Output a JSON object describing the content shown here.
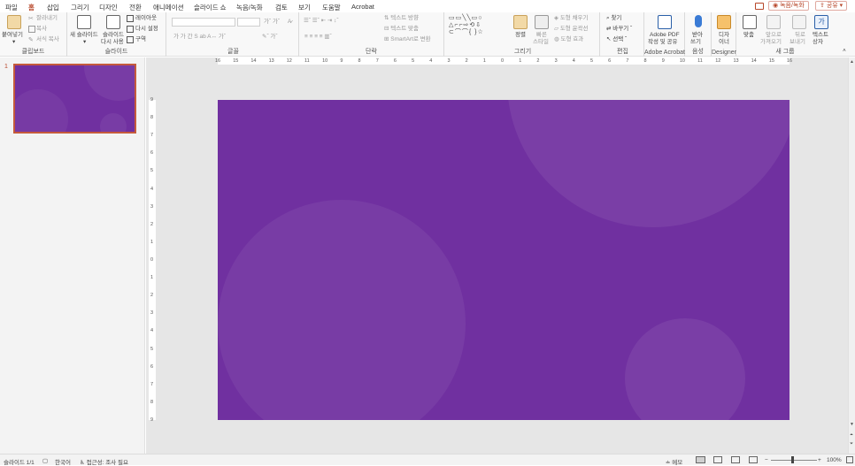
{
  "menu": {
    "tabs": [
      "파일",
      "홈",
      "삽입",
      "그리기",
      "디자인",
      "전환",
      "애니메이션",
      "슬라이드 쇼",
      "녹음/녹화",
      "검토",
      "보기",
      "도움말",
      "Acrobat"
    ],
    "active_tab": "홈",
    "record_button": "녹음/녹화",
    "share_button": "공유"
  },
  "ribbon": {
    "clipboard": {
      "paste": "붙여넣기",
      "cut": "잘라내기",
      "copy": "복사",
      "format_painter": "서식 복사",
      "group": "클립보드"
    },
    "slides": {
      "new_slide": "새 슬라이드",
      "reuse_line1": "슬라이드",
      "reuse_line2": "다시 사용",
      "layout": "레이아웃",
      "reset": "다시 설정",
      "section": "구역",
      "group": "슬라이드"
    },
    "font": {
      "group": "글꼴"
    },
    "paragraph": {
      "text_direction": "텍스트 방향",
      "align_text": "텍스트 맞춤",
      "smartart": "SmartArt로 변환",
      "group": "단락"
    },
    "drawing": {
      "arrange": "정렬",
      "quick_styles_line1": "빠른",
      "quick_styles_line2": "스타일",
      "shape_fill": "도형 채우기",
      "shape_outline": "도형 윤곽선",
      "shape_effects": "도형 효과",
      "group": "그리기"
    },
    "editing": {
      "find": "찾기",
      "replace": "바꾸기",
      "select": "선택",
      "group": "편집"
    },
    "acrobat": {
      "line1": "Adobe PDF",
      "line2": "작성 및 공유",
      "group": "Adobe Acrobat"
    },
    "voice": {
      "dictate_line1": "받아",
      "dictate_line2": "쓰기",
      "group": "음성"
    },
    "designer": {
      "ideas_line1": "디자",
      "ideas_line2": "이너",
      "group": "Designer"
    },
    "newgroup": {
      "align": "맞춤",
      "bring_line1": "앞으로",
      "bring_line2": "가져오기",
      "send_line1": "뒤로",
      "send_line2": "보내기",
      "textbox_line1": "텍스트",
      "textbox_line2": "상자",
      "group": "새 그룹"
    }
  },
  "slide_panel": {
    "slide_number": "1"
  },
  "ruler": {
    "h_labels": [
      "16",
      "15",
      "14",
      "13",
      "12",
      "11",
      "10",
      "9",
      "8",
      "7",
      "6",
      "5",
      "4",
      "3",
      "2",
      "1",
      "0",
      "1",
      "2",
      "3",
      "4",
      "5",
      "6",
      "7",
      "8",
      "9",
      "10",
      "11",
      "12",
      "13",
      "14",
      "15",
      "16"
    ],
    "v_labels": [
      "9",
      "8",
      "7",
      "6",
      "5",
      "4",
      "3",
      "2",
      "1",
      "0",
      "1",
      "2",
      "3",
      "4",
      "5",
      "6",
      "7",
      "8",
      "9"
    ]
  },
  "slide": {
    "background": "#7030a0"
  },
  "status": {
    "slide_count": "슬라이드 1/1",
    "language": "한국어",
    "accessibility": "접근성: 조사 필요",
    "notes": "메모",
    "zoom": "100%"
  },
  "colors": {
    "accent": "#b7472a",
    "slide_bg": "#7030a0",
    "thumb_border": "#c55a3c"
  }
}
